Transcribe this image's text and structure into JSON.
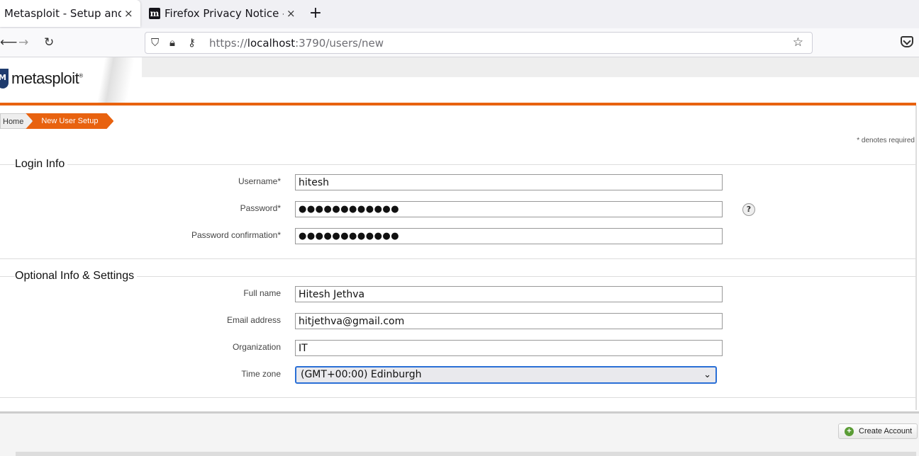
{
  "browser": {
    "tabs": [
      {
        "title": "Metasploit - Setup and",
        "active": true
      },
      {
        "title": "Firefox Privacy Notice —",
        "active": false
      }
    ],
    "new_tab_symbol": "+",
    "close_symbol": "×",
    "url_scheme": "https://",
    "url_host": "localhost",
    "url_rest": ":3790/users/new",
    "icons": [
      "back-icon",
      "forward-icon",
      "reload-icon",
      "shield-icon",
      "lock-icon",
      "key-icon",
      "star-icon",
      "pocket-icon"
    ]
  },
  "brand": {
    "logo_text": "metasploit",
    "registered": "®",
    "accent": "#e8620f"
  },
  "breadcrumb": {
    "home": "Home",
    "current": "New User Setup"
  },
  "required_note": "* denotes required",
  "login_info": {
    "title": "Login Info",
    "username_label": "Username*",
    "username_value": "hitesh",
    "password_label": "Password*",
    "password_value": "●●●●●●●●●●●●",
    "password_help": "?",
    "confirm_label": "Password confirmation*",
    "confirm_value": "●●●●●●●●●●●●"
  },
  "optional_info": {
    "title": "Optional Info & Settings",
    "fullname_label": "Full name",
    "fullname_value": "Hitesh Jethva",
    "email_label": "Email address",
    "email_value": "hitjethva@gmail.com",
    "org_label": "Organization",
    "org_value": "IT",
    "tz_label": "Time zone",
    "tz_value": "(GMT+00:00) Edinburgh"
  },
  "actions": {
    "create_label": "Create Account"
  }
}
